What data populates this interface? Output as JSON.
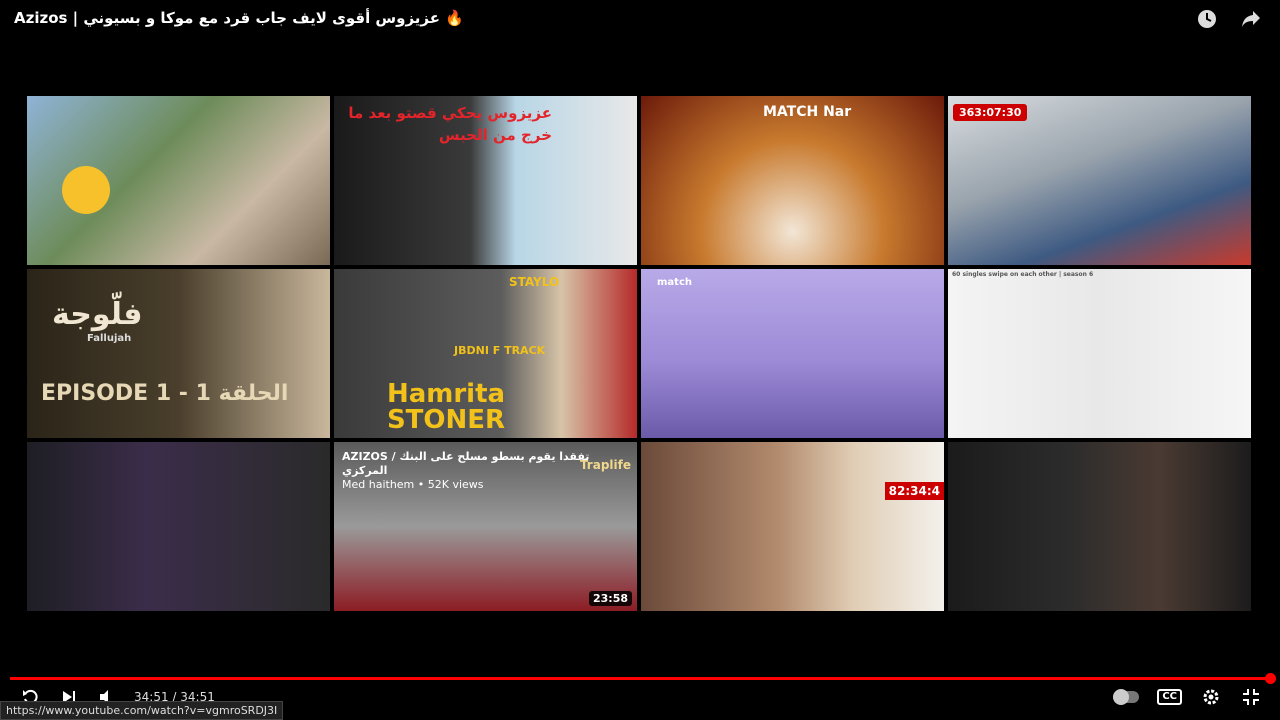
{
  "header": {
    "title": "Azizos | عزيزوس أقوى لايف جاب قرد مع موكا و بسيوني 🔥"
  },
  "icons": {
    "watch_later": "clock-icon",
    "share": "share-arrow-icon"
  },
  "tiles": [
    {
      "overlay": "",
      "duration": ""
    },
    {
      "overlay": "عزيزوس يحكي قصتو بعد ما خرج من الحبس",
      "duration": ""
    },
    {
      "overlay": "MATCH Nar",
      "duration": ""
    },
    {
      "overlay": "",
      "timer": "363:07:30",
      "duration": ""
    },
    {
      "overlay": "فلّوجة",
      "subtitle": "Fallujah",
      "caption": "EPISODE 1 - 1 الحلقة",
      "duration": ""
    },
    {
      "overlay": "Hamrita STONER",
      "tag1": "STAYLO",
      "tag2": "JBDNI F TRACK",
      "duration": ""
    },
    {
      "overlay": "match",
      "duration": ""
    },
    {
      "overlay": "60 singles swipe on each other | season 6",
      "duration": ""
    },
    {
      "overlay": "",
      "duration": ""
    },
    {
      "overlay": "AZIZOS / تفقدا يقوم بسطو مسلح على البنك المركزي",
      "channel": "Med haithem • 52K views",
      "badge": "Traplife",
      "duration": "23:58"
    },
    {
      "overlay": "",
      "timer": "82:34:4",
      "duration": ""
    },
    {
      "overlay": "",
      "duration": ""
    }
  ],
  "player": {
    "current_time": "34:51",
    "separator": " / ",
    "total_time": "34:51",
    "progress_fraction": 1.0,
    "url_tooltip": "https://www.youtube.com/watch?v=vgmroSRDJ3I",
    "accent_color": "#ff0000"
  }
}
